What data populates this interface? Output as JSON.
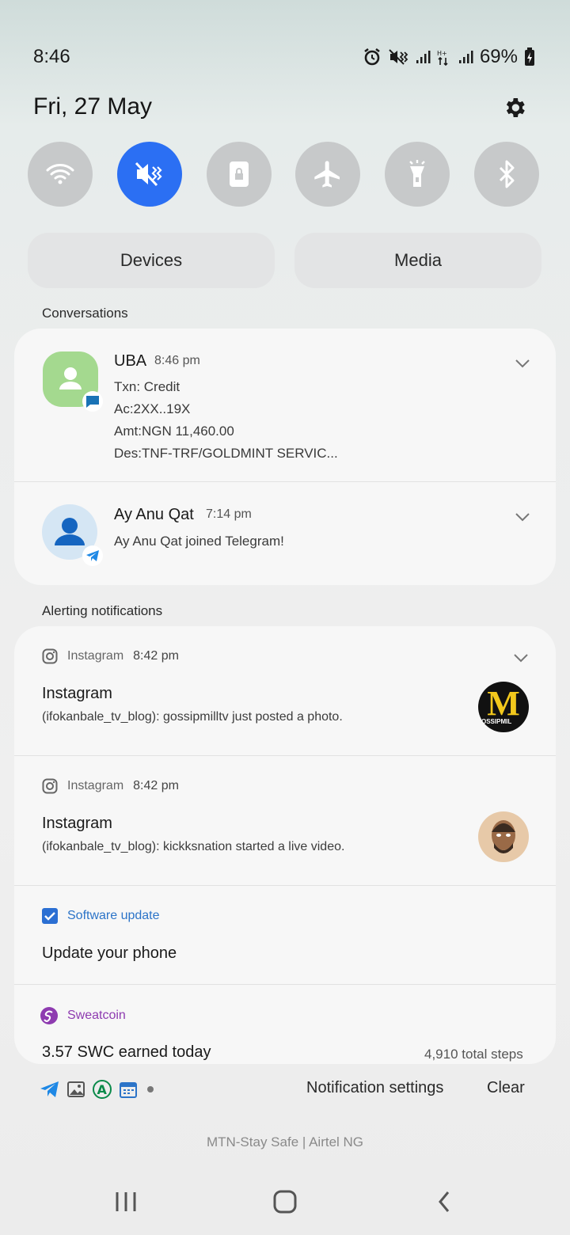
{
  "status_bar": {
    "time": "8:46",
    "battery": "69%"
  },
  "header": {
    "date": "Fri, 27 May"
  },
  "quick_settings": {
    "tiles": [
      {
        "name": "wifi",
        "active": false
      },
      {
        "name": "mute",
        "active": true
      },
      {
        "name": "lock",
        "active": false
      },
      {
        "name": "airplane",
        "active": false
      },
      {
        "name": "flashlight",
        "active": false
      },
      {
        "name": "bluetooth",
        "active": false
      }
    ],
    "devices_label": "Devices",
    "media_label": "Media"
  },
  "conversations": {
    "label": "Conversations",
    "items": [
      {
        "sender": "UBA",
        "time": "8:46 pm",
        "lines": [
          "Txn: Credit",
          "Ac:2XX..19X",
          "Amt:NGN 11,460.00",
          "Des:TNF-TRF/GOLDMINT SERVIC..."
        ]
      },
      {
        "sender": "Ay Anu Qat",
        "time": "7:14 pm",
        "lines": [
          "Ay Anu Qat joined Telegram!"
        ]
      }
    ]
  },
  "alerting": {
    "label": "Alerting notifications",
    "items": [
      {
        "app": "Instagram",
        "time": "8:42 pm",
        "title": "Instagram",
        "text": "(ifokanbale_tv_blog): gossipmilltv just posted a photo.",
        "thumb_letter": "M",
        "thumb_sub": "OSSIPMIL"
      },
      {
        "app": "Instagram",
        "time": "8:42 pm",
        "title": "Instagram",
        "text": "(ifokanbale_tv_blog): kickksnation started a live video."
      },
      {
        "app": "Software update",
        "title": "Update your phone"
      },
      {
        "app": "Sweatcoin",
        "title": "3.57 SWC earned today",
        "extra": "4,910 total steps"
      }
    ]
  },
  "footer": {
    "notification_settings": "Notification settings",
    "clear": "Clear",
    "carrier": "MTN-Stay Safe | Airtel NG"
  },
  "colors": {
    "accent": "#2b6ff3",
    "tile_inactive": "#c7c9ca",
    "sweatcoin": "#8e3bb0",
    "uba_avatar": "#a4d98f"
  }
}
